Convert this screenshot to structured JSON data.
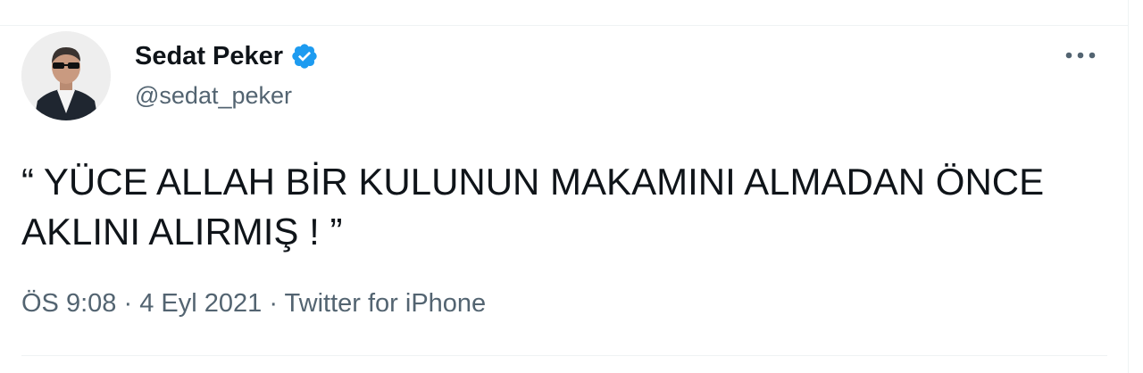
{
  "tweet": {
    "author": {
      "display_name": "Sedat Peker",
      "handle": "@sedat_peker",
      "verified": true,
      "verified_color": "#1d9bf0",
      "avatar_icon": "profile-photo"
    },
    "more_icon": "more-icon",
    "text": "“ YÜCE ALLAH BİR KULUNUN MAKAMINI ALMADAN ÖNCE AKLINI ALIRMIŞ ! ”",
    "time": "ÖS 9:08",
    "separator": "·",
    "date": "4 Eyl 2021",
    "source": "Twitter for iPhone"
  },
  "colors": {
    "text_primary": "#0f1419",
    "text_secondary": "#536471",
    "divider": "#eff3f4"
  }
}
